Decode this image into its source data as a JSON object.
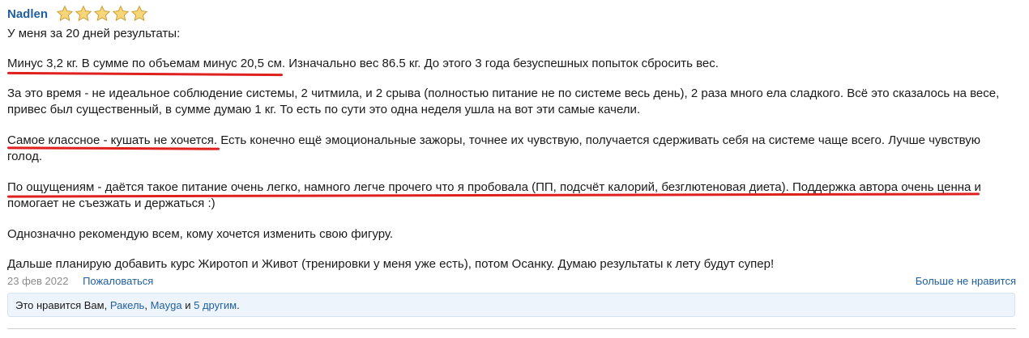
{
  "post": {
    "author": "Nadlen",
    "rating": 5,
    "rating_max": 5,
    "paragraphs": [
      "У меня за 20 дней результаты:",
      "Минус 3,2 кг. В сумме по объемам минус 20,5 см. Изначально вес 86.5 кг. До этого 3 года безуспешных попыток сбросить вес.",
      "За это время - не идеальное соблюдение системы, 2 читмила, и 2 срыва (полностью питание не по системе весь день), 2 раза много ела сладкого. Всё это сказалось на весе, привес был существенный, в сумме думаю 1 кг. То есть по сути это одна неделя ушла на вот эти самые качели.",
      "Самое классное - кушать не хочется. Есть конечно ещё эмоциональные зажоры, точнее их чувствую, получается сдерживать себя на системе чаще всего. Лучше чувствую голод.",
      "По ощущениям - даётся такое питание очень легко, намного легче прочего что я пробовала (ПП, подсчёт калорий, безглютеновая диета). Поддержка автора очень ценна и помогает не съезжать и держаться :)",
      "Однозначно рекомендую всем, кому хочется изменить свою фигуру.",
      "Дальше планирую добавить курс Жиротоп и Живот (тренировки у меня уже есть), потом Осанку. Думаю результаты к лету будут супер!"
    ],
    "date": "23 фев 2022",
    "report_label": "Пожаловаться",
    "unlike_label": "Больше не нравится",
    "likes": {
      "prefix": "Это нравится Вам,",
      "user1": "Ракель",
      "sep1": ",",
      "user2": "Mayga",
      "and": "и",
      "others": "5 другим",
      "suffix": "."
    }
  },
  "colors": {
    "link": "#1f5f9e",
    "highlight": "#e0201f",
    "star": "#f5c242"
  }
}
